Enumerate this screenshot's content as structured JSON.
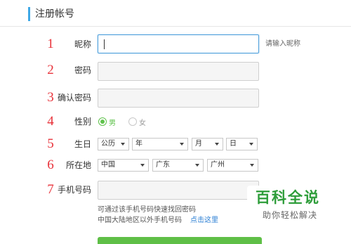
{
  "header": {
    "title": "注册帐号"
  },
  "rows": [
    {
      "num": "1",
      "label": "昵称",
      "hint": "请输入昵称"
    },
    {
      "num": "2",
      "label": "密码"
    },
    {
      "num": "3",
      "label": "确认密码"
    },
    {
      "num": "4",
      "label": "性别",
      "options": [
        {
          "label": "男",
          "checked": true
        },
        {
          "label": "女",
          "checked": false
        }
      ]
    },
    {
      "num": "5",
      "label": "生日",
      "selects": [
        "公历",
        "年",
        "月",
        "日"
      ]
    },
    {
      "num": "6",
      "label": "所在地",
      "selects": [
        "中国",
        "广东",
        "广州"
      ]
    },
    {
      "num": "7",
      "label": "手机号码"
    }
  ],
  "phone_notes": {
    "line1": "可通过该手机号码快速找回密码",
    "line2": "中国大陆地区以外手机号码",
    "link": "点击这里"
  },
  "watermark": {
    "title": "百科全说",
    "subtitle": "助你轻松解决"
  },
  "colors": {
    "accent": "#3ea8e6",
    "number": "#e8323a",
    "radio_checked": "#5fc24b",
    "link": "#2b7fd4",
    "button": "#5fbf47"
  }
}
